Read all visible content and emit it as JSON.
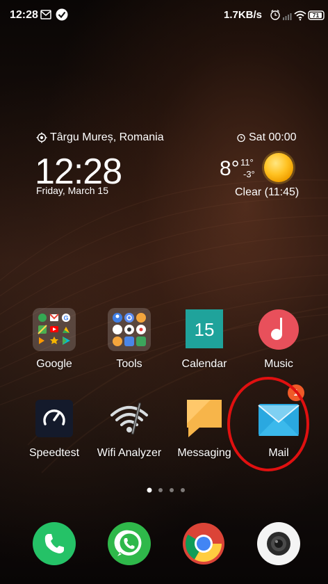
{
  "status_bar": {
    "time": "12:28",
    "network_speed": "1.7KB/s",
    "battery": "71",
    "icons": [
      "mail-icon",
      "check-icon",
      "alarm-icon",
      "signal-icon",
      "wifi-icon",
      "battery-icon"
    ]
  },
  "widget": {
    "location": "Târgu Mureș, Romania",
    "alarm": "Sat 00:00",
    "time": "12:28",
    "date": "Friday, March 15",
    "temperature": "8°",
    "temp_high": "11°",
    "temp_low": "-3°",
    "condition": "Clear  (11:45)"
  },
  "apps_row1": [
    {
      "label": "Google",
      "icon": "google-folder-icon"
    },
    {
      "label": "Tools",
      "icon": "tools-folder-icon"
    },
    {
      "label": "Calendar",
      "icon": "calendar-icon",
      "day": "15"
    },
    {
      "label": "Music",
      "icon": "music-icon"
    }
  ],
  "apps_row2": [
    {
      "label": "Speedtest",
      "icon": "speedtest-icon"
    },
    {
      "label": "Wifi Analyzer",
      "icon": "wifi-analyzer-icon"
    },
    {
      "label": "Messaging",
      "icon": "messaging-icon"
    },
    {
      "label": "Mail",
      "icon": "mail-app-icon",
      "badge": "1"
    }
  ],
  "page_indicator": {
    "pages": 4,
    "current": 1
  },
  "dock": [
    {
      "icon": "phone-icon"
    },
    {
      "icon": "whatsapp-icon"
    },
    {
      "icon": "chrome-icon"
    },
    {
      "icon": "camera-icon"
    }
  ],
  "colors": {
    "highlight_circle": "#e01010",
    "badge": "#f05a28",
    "calendar": "#1fa39b",
    "music": "#e8505b",
    "mail": "#3bb4e6",
    "phone": "#25c267"
  }
}
